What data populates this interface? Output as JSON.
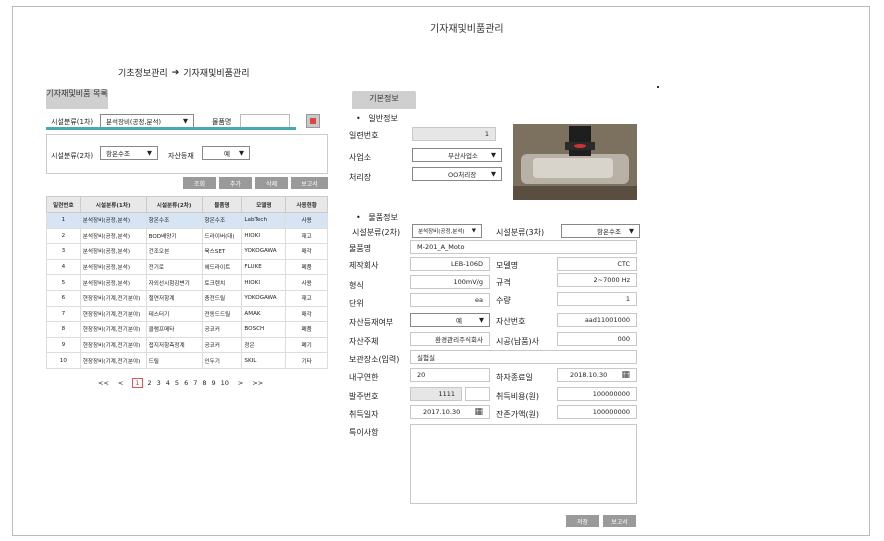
{
  "page": {
    "title": "기자재및비품관리"
  },
  "breadcrumb": {
    "parent": "기초정보관리",
    "arrow": "➔",
    "current": "기자재및비품관리"
  },
  "left": {
    "tab_label": "기자재및비품 목록",
    "filter1": {
      "label": "시설분류(1차)",
      "value": "분석장비(공정,분석)",
      "item_label": "물품명",
      "item_value": ""
    },
    "filter2": {
      "label": "시설분류(2차)",
      "value": "항온수조",
      "asset_label": "자산등재",
      "asset_value": "예"
    },
    "buttons": {
      "search": "조회",
      "add": "추가",
      "delete": "삭제",
      "report": "보고서"
    },
    "table": {
      "headers": [
        "일련번호",
        "시설분류(1차)",
        "시설분류(2차)",
        "물품명",
        "모델명",
        "사용현황"
      ],
      "rows": [
        [
          "1",
          "분석장비(공정,분석)",
          "항온수조",
          "항온수조",
          "LabTech",
          "사용"
        ],
        [
          "2",
          "분석장비(공정,분석)",
          "BOD배양기",
          "드라이버(대)",
          "HIOKI",
          "재고"
        ],
        [
          "3",
          "분석장비(공정,분석)",
          "건조오븐",
          "육스SET",
          "YOKOGAWA",
          "매각"
        ],
        [
          "4",
          "분석장비(공정,분석)",
          "전기로",
          "헤드라이트",
          "FLUKE",
          "폐품"
        ],
        [
          "5",
          "분석장비(공정,분석)",
          "자외선시험감변기",
          "토크렌치",
          "HIOKI",
          "사용"
        ],
        [
          "6",
          "현장장비(기계,전기분야)",
          "절연저항계",
          "충전드릴",
          "YOKOGAWA",
          "재고"
        ],
        [
          "7",
          "현장장비(기계,전기분야)",
          "테스터기",
          "전동드드릴",
          "AMAK",
          "매각"
        ],
        [
          "8",
          "현장장비(기계,전기분야)",
          "클램프메타",
          "공코커",
          "BOSCH",
          "폐품"
        ],
        [
          "9",
          "현장장비(기계,전기분야)",
          "접지저항측정계",
          "공코커",
          "정은",
          "폐기"
        ],
        [
          "10",
          "현장장비(기계,전기분야)",
          "드릴",
          "인두기",
          "SKIL",
          "기타"
        ]
      ]
    },
    "pager": {
      "first": "<<",
      "prev": "<",
      "pages": [
        "1",
        "2",
        "3",
        "4",
        "5",
        "6",
        "7",
        "8",
        "9",
        "10"
      ],
      "next": ">",
      "last": ">>"
    }
  },
  "right": {
    "tab_label": "기본정보",
    "general": {
      "heading": "일반정보",
      "serial_label": "일련번호",
      "serial_value": "1",
      "office_label": "사업소",
      "office_value": "부산사업소",
      "plant_label": "처리장",
      "plant_value": "OO처리장"
    },
    "item": {
      "heading": "물품정보",
      "cat2_label": "시설분류(2차)",
      "cat2_value": "분석장비(공정,분석)",
      "cat3_label": "시설분류(3차)",
      "cat3_value": "항온수조",
      "name_label": "물품명",
      "name_value": "M-201_A_Moto",
      "maker_label": "제작회사",
      "maker_value": "LEB-106D",
      "model_label": "모델명",
      "model_value": "CTC",
      "format_label": "형식",
      "format_value": "100mV/g",
      "spec_label": "규격",
      "spec_value": "2~7000 Hz",
      "unit_label": "단위",
      "unit_value": "ea",
      "qty_label": "수량",
      "qty_value": "1",
      "asset_reg_label": "자산등재여부",
      "asset_reg_value": "예",
      "asset_no_label": "자산번호",
      "asset_no_value": "aad11001000",
      "owner_label": "자산주체",
      "owner_value": "환경관리주식회사",
      "vendor_label": "시공(납품)사",
      "vendor_value": "000",
      "storage_label": "보관장소(입력)",
      "storage_value": "실험실",
      "life_label": "내구연한",
      "life_value": "20",
      "warranty_label": "하자종료일",
      "warranty_value": "2018.10.30",
      "order_label": "발주번호",
      "order_value": "1111",
      "cost_label": "취득비용(원)",
      "cost_value": "100000000",
      "acq_date_label": "취득일자",
      "acq_date_value": "2017.10.30",
      "remain_label": "잔존가액(원)",
      "remain_value": "100000000",
      "notes_label": "특이사항"
    },
    "buttons": {
      "save": "저장",
      "report": "보고서"
    }
  }
}
